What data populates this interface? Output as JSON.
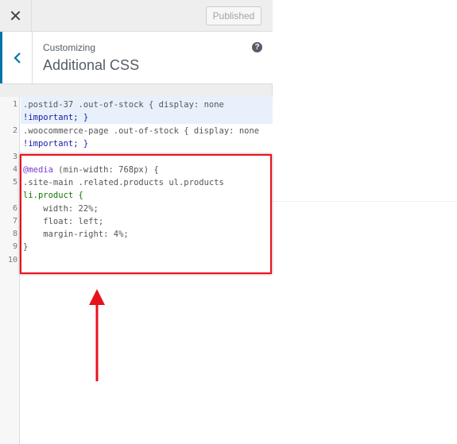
{
  "topbar": {
    "close_symbol": "✕",
    "published_label": "Published"
  },
  "section": {
    "customizing_label": "Customizing",
    "title": "Additional CSS",
    "back_icon": "chevron-left-icon",
    "help_icon": "help-icon",
    "help_symbol": "?"
  },
  "editor": {
    "line_numbers": [
      "1",
      "2",
      "3",
      "4",
      "5",
      "6",
      "7",
      "8",
      "9",
      "10"
    ],
    "code": {
      "l1a": ".postid-37 .out-of-stock { display: none",
      "l1b": "!important; }",
      "l2a": ".woocommerce-page .out-of-stock { display: none",
      "l2b": "!important; }",
      "l4_at": "@media",
      "l4_rest": " (min-width: 768px) {",
      "l5a": ".site-main .related.products ul.products",
      "l5b": "li.product {",
      "l6": "    width: 22%;",
      "l7": "    float: left;",
      "l8": "    margin-right: 4%;",
      "l9": "}"
    }
  },
  "colors": {
    "highlight_box": "#e8121c",
    "accent": "#0073aa"
  }
}
